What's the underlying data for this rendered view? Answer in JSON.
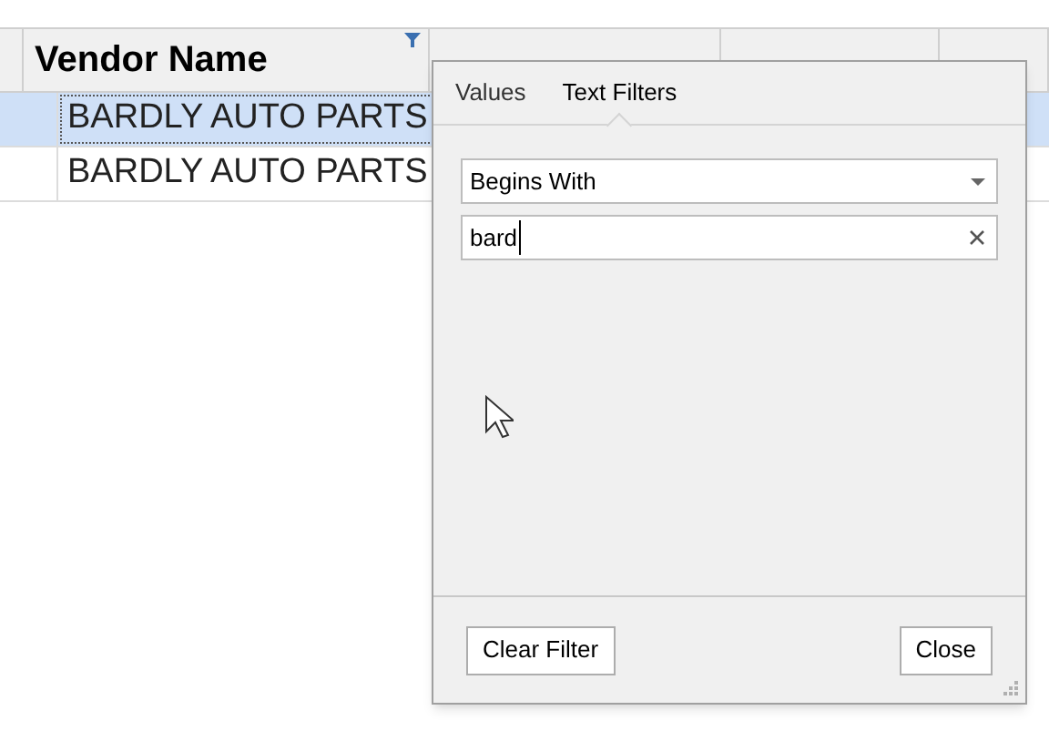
{
  "grid": {
    "columns": [
      {
        "label": "Vendor Name",
        "filtered": true
      }
    ],
    "rows": [
      {
        "vendor_name": "BARDLY AUTO PARTS",
        "selected": true
      },
      {
        "vendor_name": "BARDLY AUTO PARTS",
        "selected": false
      }
    ]
  },
  "filter_popup": {
    "tabs": [
      {
        "label": "Values",
        "selected": false
      },
      {
        "label": "Text Filters",
        "selected": true
      }
    ],
    "condition": "Begins With",
    "value": "bard",
    "buttons": [
      "Clear Filter",
      "Close"
    ]
  }
}
